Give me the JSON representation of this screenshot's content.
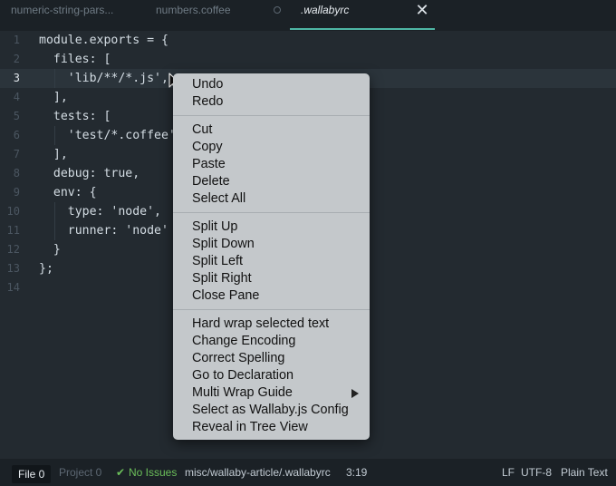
{
  "tabs": [
    {
      "label": "numeric-string-pars..."
    },
    {
      "label": "numbers.coffee"
    },
    {
      "label": ".wallabyrc"
    }
  ],
  "editor": {
    "current_line": 3,
    "lines": [
      {
        "num": "1",
        "code": "module.exports = {"
      },
      {
        "num": "2",
        "code": "  files: ["
      },
      {
        "num": "3",
        "code": "    'lib/**/*.js',"
      },
      {
        "num": "4",
        "code": "  ],"
      },
      {
        "num": "5",
        "code": "  tests: ["
      },
      {
        "num": "6",
        "code": "    'test/*.coffee'"
      },
      {
        "num": "7",
        "code": "  ],"
      },
      {
        "num": "8",
        "code": "  debug: true,"
      },
      {
        "num": "9",
        "code": "  env: {"
      },
      {
        "num": "10",
        "code": "    type: 'node',"
      },
      {
        "num": "11",
        "code": "    runner: 'node'"
      },
      {
        "num": "12",
        "code": "  }"
      },
      {
        "num": "13",
        "code": "};"
      },
      {
        "num": "14",
        "code": ""
      }
    ]
  },
  "context_menu": {
    "groups": [
      [
        "Undo",
        "Redo"
      ],
      [
        "Cut",
        "Copy",
        "Paste",
        "Delete",
        "Select All"
      ],
      [
        "Split Up",
        "Split Down",
        "Split Left",
        "Split Right",
        "Close Pane"
      ],
      [
        "Hard wrap selected text",
        "Change Encoding",
        "Correct Spelling",
        "Go to Declaration",
        "Multi Wrap Guide",
        "Select as Wallaby.js Config",
        "Reveal in Tree View"
      ]
    ],
    "submenu_item": "Multi Wrap Guide"
  },
  "status": {
    "file_label": "File 0",
    "project_label": "Project 0",
    "issues": "No Issues",
    "path": "misc/wallaby-article/.wallabyrc",
    "cursor": "3:19",
    "line_ending": "LF",
    "encoding": "UTF-8",
    "grammar": "Plain Text"
  },
  "colors": {
    "accent": "#4fb6a5",
    "success": "#6bbf5a",
    "background": "#232a30"
  }
}
